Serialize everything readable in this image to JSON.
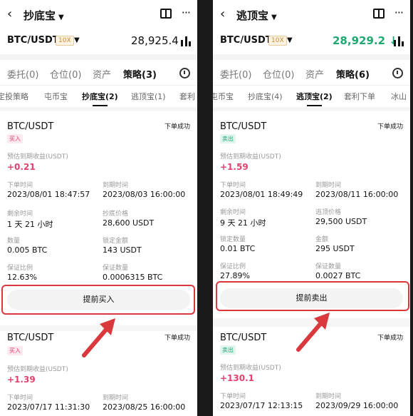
{
  "left": {
    "title": "抄底宝",
    "pair": "BTC/USDT",
    "leverage": "10X",
    "price": "28,925.4",
    "tabs": [
      "委托(0)",
      "仓位(0)",
      "资产",
      "策略(3)"
    ],
    "subtabs": [
      "定投策略",
      "屯币宝",
      "抄底宝(2)",
      "逃顶宝(1)",
      "套利"
    ],
    "card1": {
      "pair": "BTC/USDT",
      "status": "下单成功",
      "side": "买入",
      "est_label": "预估到期收益(USDT)",
      "est_value": "+0.21",
      "f1_label": "下单时间",
      "f1_value": "2023/08/01 18:47:57",
      "f2_label": "到期时间",
      "f2_value": "2023/08/03 16:00:00",
      "f3_label": "剩余时间",
      "f3_value": "1 天 21 小时",
      "f4_label": "抄底价格",
      "f4_value": "28,600 USDT",
      "f5_label": "数量",
      "f5_value": "0.005 BTC",
      "f6_label": "锁定金额",
      "f6_value": "143 USDT",
      "f7_label": "保证比例",
      "f7_value": "12.63%",
      "f8_label": "保证数量",
      "f8_value": "0.0006315 BTC",
      "button": "提前买入"
    },
    "card2": {
      "pair": "BTC/USDT",
      "status": "下单成功",
      "side": "买入",
      "est_label": "预估到期收益(USDT)",
      "est_value": "+1.39",
      "f1_label": "下单时间",
      "f1_value": "2023/07/17 11:31:30",
      "f2_label": "到期时间",
      "f2_value": "2023/08/25 16:00:00"
    }
  },
  "right": {
    "title": "逃顶宝",
    "pair": "BTC/USDT",
    "leverage": "10X",
    "price": "28,929.2",
    "price_arrow": "↓",
    "tabs": [
      "委托(0)",
      "仓位(0)",
      "资产",
      "策略(6)"
    ],
    "subtabs": [
      "屯币宝",
      "抄底宝(4)",
      "逃顶宝(2)",
      "套利下单",
      "冰山"
    ],
    "card1": {
      "pair": "BTC/USDT",
      "status": "下单成功",
      "side": "卖出",
      "est_label": "预估到期收益(USDT)",
      "est_value": "+1.59",
      "f1_label": "下单时间",
      "f1_value": "2023/08/01 18:49:49",
      "f2_label": "到期时间",
      "f2_value": "2023/08/11 16:00:00",
      "f3_label": "剩余时间",
      "f3_value": "9 天 21 小时",
      "f4_label": "逃顶价格",
      "f4_value": "29,500 USDT",
      "f5_label": "锁定数量",
      "f5_value": "0.01 BTC",
      "f6_label": "金额",
      "f6_value": "295 USDT",
      "f7_label": "保证比例",
      "f7_value": "27.89%",
      "f8_label": "保证数量",
      "f8_value": "0.0027 BTC",
      "button": "提前卖出"
    },
    "card2": {
      "pair": "BTC/USDT",
      "status": "下单成功",
      "side": "卖出",
      "est_label": "预估到期收益(USDT)",
      "est_value": "+130.1",
      "f1_label": "下单时间",
      "f1_value": "2023/07/17 12:13:15",
      "f2_label": "到期时间",
      "f2_value": "2023/09/29 16:00:00"
    }
  },
  "colors": {
    "buy": "#e0416e",
    "sell": "#1fa870",
    "highlight": "#d9383c",
    "leverage": "#d08a2c"
  }
}
